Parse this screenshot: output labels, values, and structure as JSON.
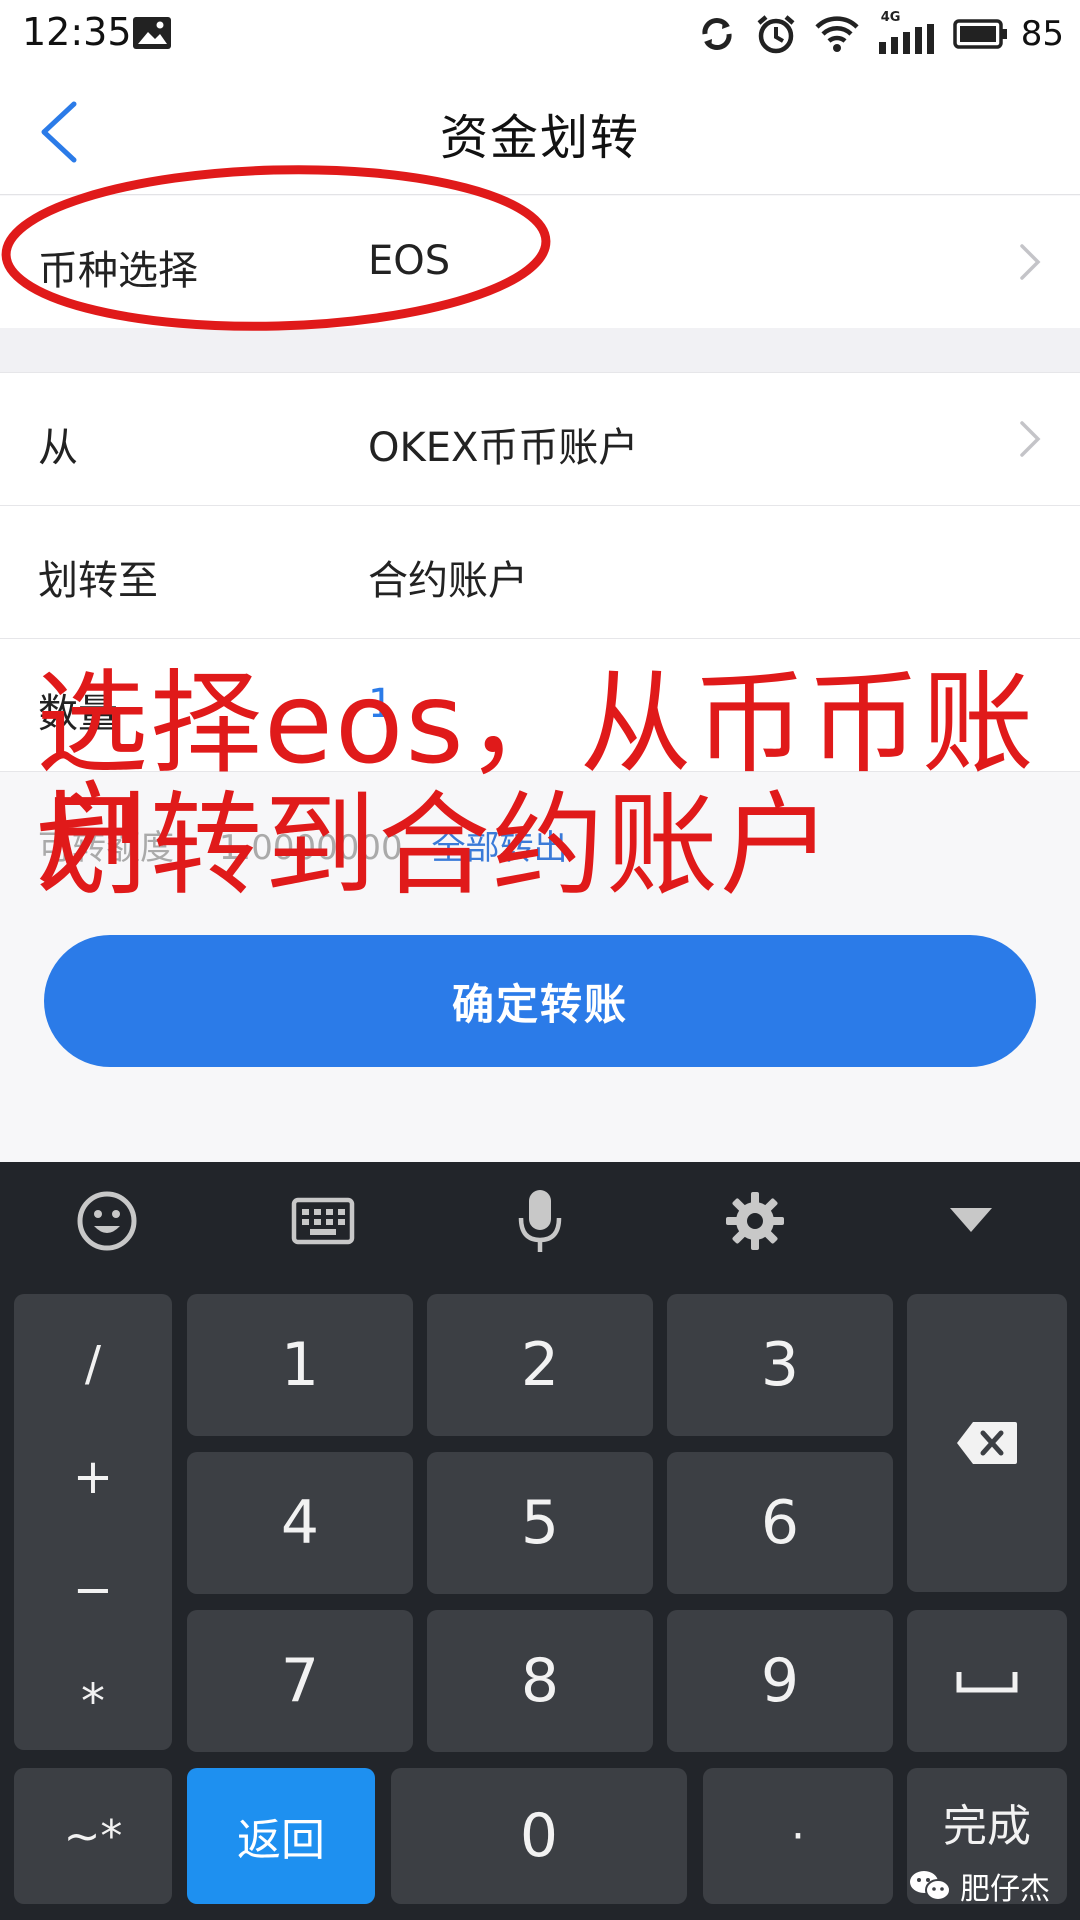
{
  "status_bar": {
    "time": "12:35",
    "network": "4G",
    "battery": "85"
  },
  "nav": {
    "title": "资金划转"
  },
  "form": {
    "coin": {
      "label": "币种选择",
      "value": "EOS"
    },
    "from": {
      "label": "从",
      "value": "OKEX币币账户"
    },
    "to": {
      "label": "划转至",
      "value": "合约账户"
    },
    "amount": {
      "label": "数量",
      "value": "1"
    },
    "available": {
      "label": "可转额度：",
      "value": "1.0000000",
      "link": "全部转出"
    }
  },
  "confirm_button": "确定转账",
  "annotation": {
    "line1": "选择eos，从币币账户",
    "line2": "划转到合约账户",
    "color": "#e01a1a"
  },
  "keyboard": {
    "symbols": [
      "/",
      "+",
      "−",
      "*"
    ],
    "digits": [
      "1",
      "2",
      "3",
      "4",
      "5",
      "6",
      "7",
      "8",
      "9",
      "0"
    ],
    "tilde_key": "~*",
    "back_key": "返回",
    "dot_key": "·",
    "done_key": "完成"
  },
  "watermark": "肥仔杰",
  "colors": {
    "accent": "#2b7be8",
    "link": "#3a7ad8",
    "keyboard_bg": "#22252a",
    "key_bg": "#3c3f44",
    "back_key_bg": "#1e90f0"
  }
}
